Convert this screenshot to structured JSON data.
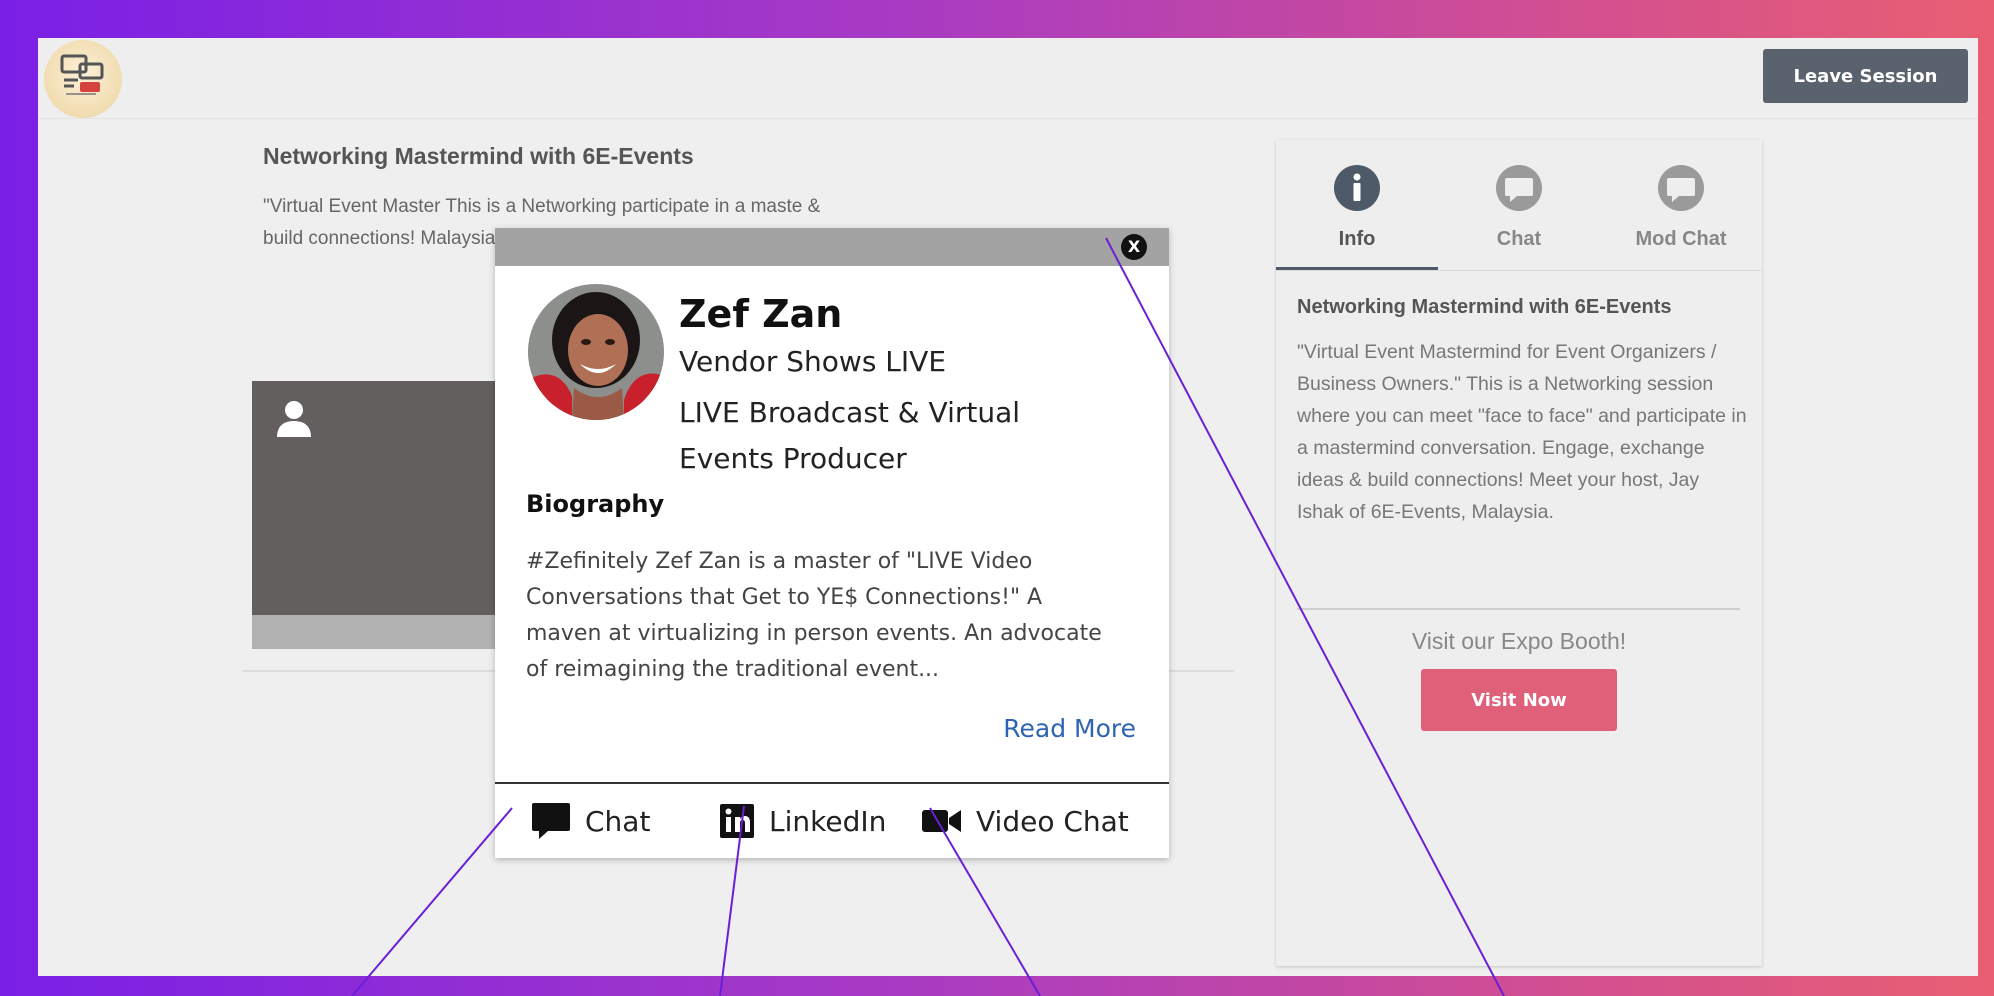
{
  "header": {
    "leave_label": "Leave Session"
  },
  "session": {
    "title": "Networking Mastermind with 6E-Events",
    "description_visible": "\"Virtual Event Master This is a Networking participate in a maste & build connections! Malaysia."
  },
  "right_panel": {
    "tabs": [
      {
        "label": "Info",
        "icon": "info-icon",
        "active": true
      },
      {
        "label": "Chat",
        "icon": "chat-bubble-icon",
        "active": false
      },
      {
        "label": "Mod Chat",
        "icon": "chat-bubble-icon",
        "active": false
      }
    ],
    "title": "Networking Mastermind with 6E-Events",
    "description": "\"Virtual Event Mastermind for Event Organizers / Business Owners.\" This is a Networking session where you can meet \"face to face\" and participate in a mastermind conversation. Engage, exchange ideas & build connections! Meet your host, Jay Ishak of 6E-Events, Malaysia.",
    "expo_text": "Visit our Expo Booth!",
    "visit_label": "Visit Now"
  },
  "modal": {
    "close_label": "X",
    "name": "Zef Zan",
    "company": "Vendor Shows LIVE",
    "role": "LIVE Broadcast & Virtual Events Producer",
    "bio_heading": "Biography",
    "bio": "#Zefinitely Zef Zan is a master of \"LIVE Video Conversations that Get to YE$ Connections!\" A maven at virtualizing in person events. An advocate of reimagining the traditional event...",
    "read_more": "Read More",
    "actions": [
      {
        "label": "Chat",
        "icon": "chat-icon"
      },
      {
        "label": "LinkedIn",
        "icon": "linkedin-icon"
      },
      {
        "label": "Video Chat",
        "icon": "video-camera-icon"
      }
    ]
  },
  "colors": {
    "accent_pink": "#e06079",
    "leave_button": "#59626d",
    "annotation_line": "#6a1fd6",
    "link_blue": "#2d64b3"
  }
}
